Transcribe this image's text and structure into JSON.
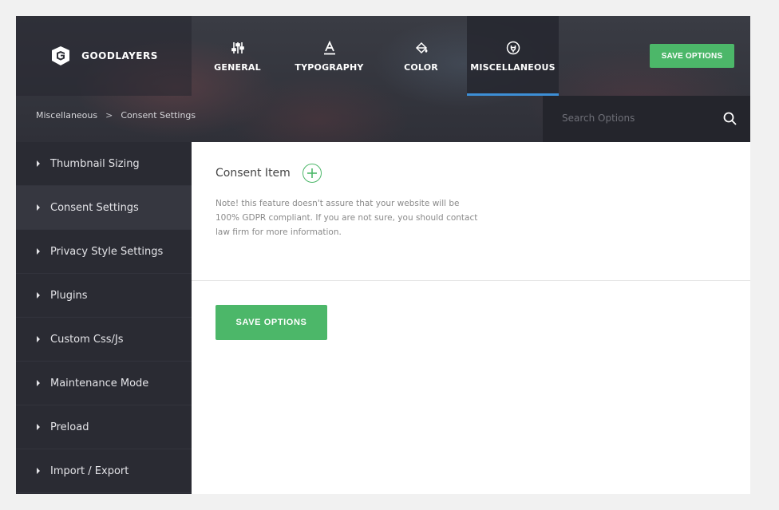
{
  "brand": {
    "name": "GOODLAYERS",
    "logo_icon": "goodlayers-logo-icon"
  },
  "tabs": [
    {
      "label": "GENERAL",
      "icon": "sliders-icon",
      "active": false
    },
    {
      "label": "TYPOGRAPHY",
      "icon": "font-icon",
      "active": false
    },
    {
      "label": "COLOR",
      "icon": "paint-bucket-icon",
      "active": false
    },
    {
      "label": "MISCELLANEOUS",
      "icon": "plug-icon",
      "active": true
    }
  ],
  "header": {
    "save_label": "SAVE OPTIONS"
  },
  "breadcrumb": {
    "parent": "Miscellaneous",
    "separator": ">",
    "current": "Consent Settings"
  },
  "search": {
    "placeholder": "Search Options",
    "icon": "search-icon"
  },
  "sidebar": {
    "items": [
      {
        "label": "Thumbnail Sizing",
        "active": false
      },
      {
        "label": "Consent Settings",
        "active": true
      },
      {
        "label": "Privacy Style Settings",
        "active": false
      },
      {
        "label": "Plugins",
        "active": false
      },
      {
        "label": "Custom Css/Js",
        "active": false
      },
      {
        "label": "Maintenance Mode",
        "active": false
      },
      {
        "label": "Preload",
        "active": false
      },
      {
        "label": "Import / Export",
        "active": false
      }
    ]
  },
  "main": {
    "consent_title": "Consent Item",
    "add_icon": "plus-circle-icon",
    "note": "Note! this feature doesn't assure that your website will be 100% GDPR compliant. If you are not sure, you should contact law firm for more information.",
    "save_label": "SAVE OPTIONS"
  },
  "colors": {
    "accent_green": "#4cb769",
    "active_tab_underline": "#3d8fd6",
    "sidebar_bg": "#2a2b33",
    "sidebar_active_bg": "#363740"
  }
}
